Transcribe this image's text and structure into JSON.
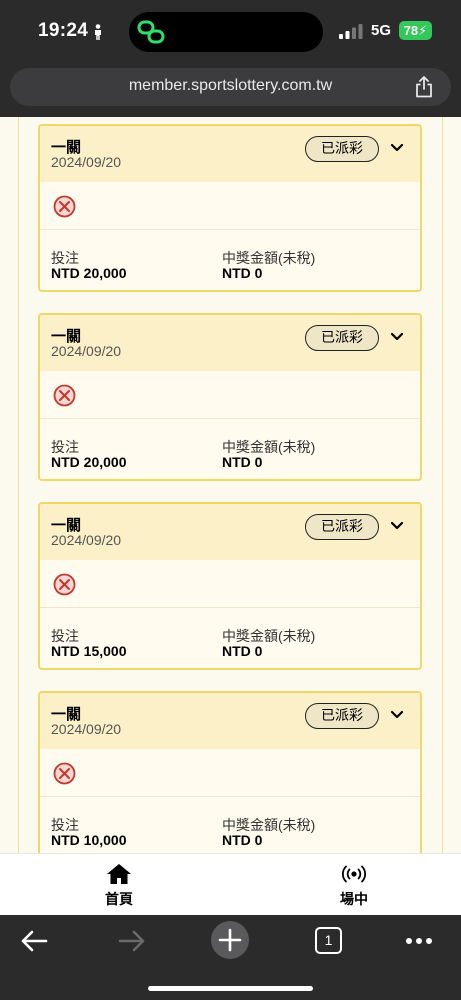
{
  "status_bar": {
    "time": "19:24",
    "network": "5G",
    "battery": "78"
  },
  "browser": {
    "url": "member.sportslottery.com.tw"
  },
  "bets": [
    {
      "title": "一關",
      "date": "2024/09/20",
      "status": "已派彩",
      "stake_label": "投注",
      "stake_value": "NTD 20,000",
      "payout_label": "中獎金額(未稅)",
      "payout_value": "NTD 0"
    },
    {
      "title": "一關",
      "date": "2024/09/20",
      "status": "已派彩",
      "stake_label": "投注",
      "stake_value": "NTD 20,000",
      "payout_label": "中獎金額(未稅)",
      "payout_value": "NTD 0"
    },
    {
      "title": "一關",
      "date": "2024/09/20",
      "status": "已派彩",
      "stake_label": "投注",
      "stake_value": "NTD 15,000",
      "payout_label": "中獎金額(未稅)",
      "payout_value": "NTD 0"
    },
    {
      "title": "一關",
      "date": "2024/09/20",
      "status": "已派彩",
      "stake_label": "投注",
      "stake_value": "NTD 10,000",
      "payout_label": "中獎金額(未稅)",
      "payout_value": "NTD 0"
    }
  ],
  "nav": {
    "home_label": "首頁",
    "live_label": "場中"
  },
  "colors": {
    "card_border": "#f1d767",
    "card_header": "#fcf0c8",
    "lose_icon": "#c0392b"
  },
  "icons": [
    "person-icon",
    "link-icon",
    "signal-icon",
    "share-icon",
    "lose-icon",
    "chevron-down-icon",
    "home-icon",
    "broadcast-icon",
    "back-arrow-icon",
    "forward-arrow-icon",
    "new-tab-icon",
    "tab-count-icon",
    "more-icon"
  ],
  "toolbar": {
    "tab_count": "1"
  }
}
